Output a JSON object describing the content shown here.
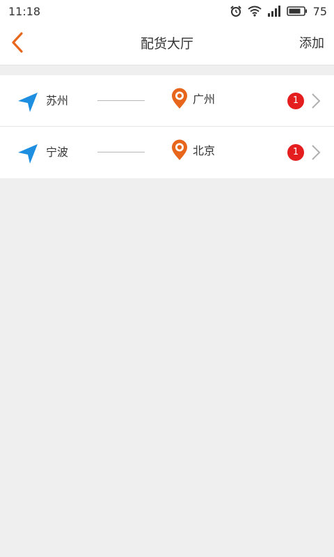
{
  "status_bar": {
    "time": "11:18",
    "battery_level": "75",
    "icons": [
      "alarm-icon",
      "wifi-icon",
      "signal-icon",
      "battery-icon"
    ]
  },
  "nav": {
    "back_icon": "chevron-left-icon",
    "title": "配货大厅",
    "action_label": "添加"
  },
  "routes": [
    {
      "origin": "苏州",
      "destination": "广州",
      "count": "1"
    },
    {
      "origin": "宁波",
      "destination": "北京",
      "count": "1"
    }
  ],
  "colors": {
    "accent_orange": "#e8661c",
    "origin_blue": "#1e8fe0",
    "badge_red": "#e41e1e",
    "background": "#efefef"
  }
}
